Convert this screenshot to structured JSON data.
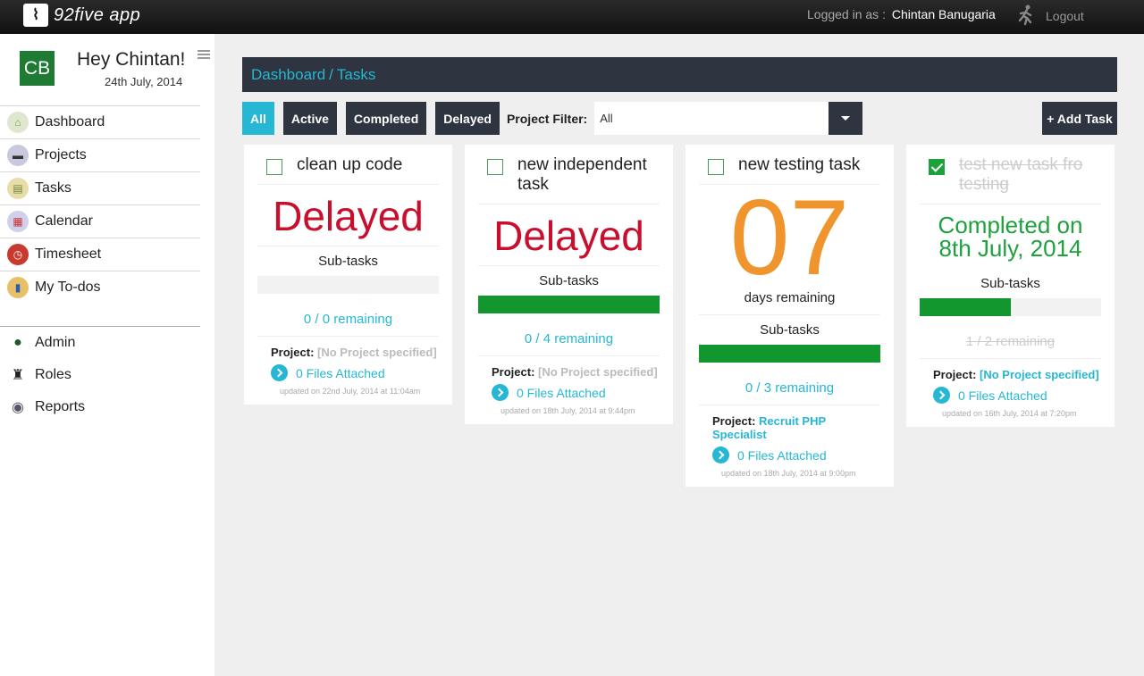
{
  "app": {
    "logo_text": "92five app"
  },
  "topbar": {
    "logged_label": "Logged in as :",
    "username": "Chintan Banugaria",
    "logout_label": "Logout"
  },
  "sidebar": {
    "avatar_initials": "CB",
    "greeting": "Hey Chintan!",
    "date": "24th July, 2014",
    "items": [
      {
        "label": "Dashboard",
        "icon": "home-icon",
        "color": "#7aa33d"
      },
      {
        "label": "Projects",
        "icon": "briefcase-icon",
        "color": "#5b5b8a"
      },
      {
        "label": "Tasks",
        "icon": "clipboard-icon",
        "color": "#c3a13a"
      },
      {
        "label": "Calendar",
        "icon": "calendar-icon",
        "color": "#7a7fc2"
      },
      {
        "label": "Timesheet",
        "icon": "clock-icon",
        "color": "#c83a2e"
      },
      {
        "label": "My To-dos",
        "icon": "notebook-icon",
        "color": "#d9a436"
      }
    ],
    "admin_items": [
      {
        "label": "Admin",
        "icon": "user-icon"
      },
      {
        "label": "Roles",
        "icon": "suit-icon"
      },
      {
        "label": "Reports",
        "icon": "eye-icon"
      }
    ]
  },
  "breadcrumb": {
    "root": "Dashboard",
    "separator": "/",
    "current": "Tasks"
  },
  "filters": {
    "buttons": [
      "All",
      "Active",
      "Completed",
      "Delayed"
    ],
    "active": "All",
    "project_filter_label": "Project Filter:",
    "project_filter_value": "All",
    "add_task_label": "+ Add Task"
  },
  "colors": {
    "accent": "#25b7d3",
    "dark": "#2f3540",
    "delayed": "#c8102e",
    "days": "#f0952e",
    "green": "#12962e"
  },
  "cards": [
    {
      "title": "clean up code",
      "status": "Delayed",
      "subtasks_label": "Sub-tasks",
      "progress": 0,
      "remaining": "0 / 0 remaining",
      "project_label": "Project:",
      "project": "[No Project specified]",
      "files": "0 Files Attached",
      "updated": "updated on 22nd July, 2014 at 11:04am"
    },
    {
      "title": "new independent task",
      "status": "Delayed",
      "subtasks_label": "Sub-tasks",
      "progress": 1.0,
      "remaining": "0 / 4 remaining",
      "project_label": "Project:",
      "project": "[No Project specified]",
      "files": "0 Files Attached",
      "updated": "updated on 18th July, 2014 at 9:44pm"
    },
    {
      "title": "new testing task",
      "days": "07",
      "days_label": "days remaining",
      "subtasks_label": "Sub-tasks",
      "progress": 1.0,
      "remaining": "0 / 3 remaining",
      "project_label": "Project:",
      "project": "Recruit PHP Specialist",
      "files": "0 Files Attached",
      "updated": "updated on 18th July, 2014 at 9:00pm"
    },
    {
      "title": "test new task fro testing",
      "completed": "Completed on 8th July, 2014",
      "subtasks_label": "Sub-tasks",
      "progress": 0.5,
      "remaining": "1 / 2 remaining",
      "project_label": "Project:",
      "project": "[No Project specified]",
      "files": "0 Files Attached",
      "updated": "updated on 16th July, 2014 at 7:20pm"
    }
  ]
}
